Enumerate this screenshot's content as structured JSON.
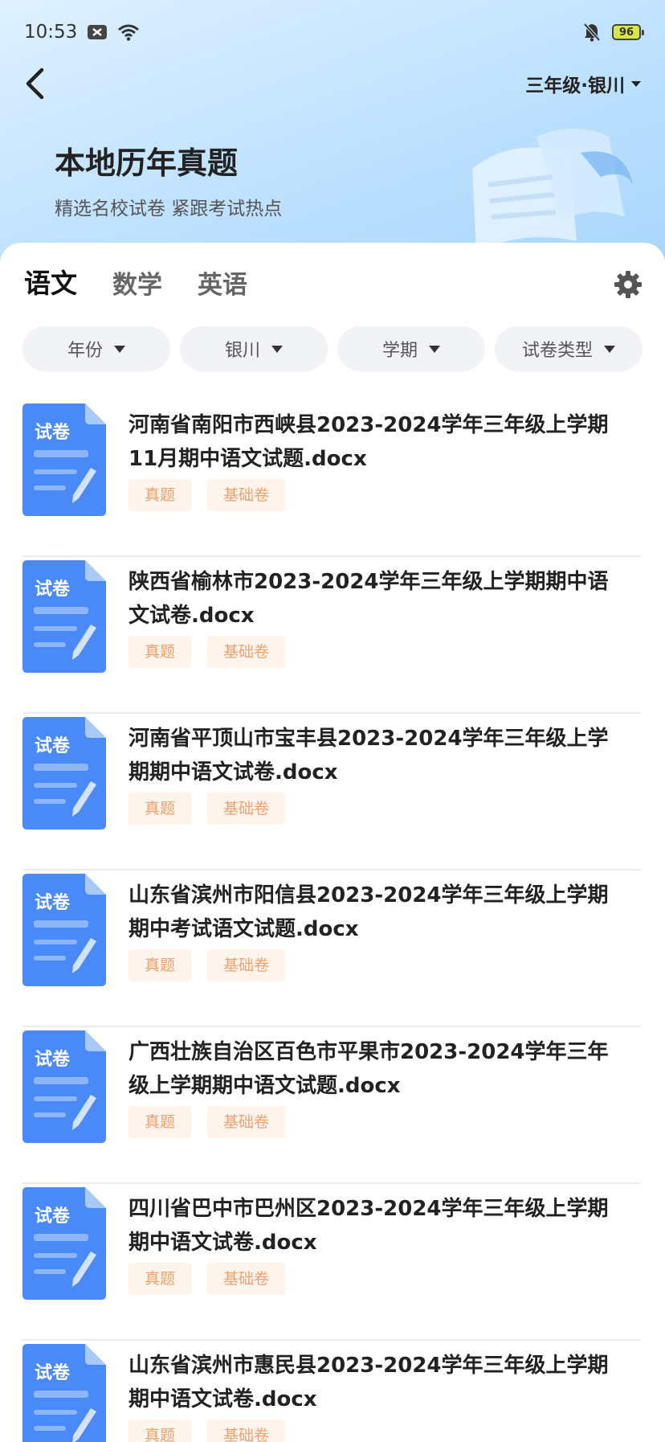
{
  "status_bar": {
    "time": "10:53",
    "battery": "96"
  },
  "header": {
    "grade_region": "三年级·银川",
    "title": "本地历年真题",
    "subtitle": "精选名校试卷 紧跟考试热点"
  },
  "tabs": [
    {
      "label": "语文",
      "active": true
    },
    {
      "label": "数学",
      "active": false
    },
    {
      "label": "英语",
      "active": false
    }
  ],
  "filters": [
    {
      "label": "年份"
    },
    {
      "label": "银川"
    },
    {
      "label": "学期"
    },
    {
      "label": "试卷类型"
    }
  ],
  "doc_icon_label": "试卷",
  "colors": {
    "accent": "#4a8af8",
    "tag_text": "#f0a06b",
    "tag_bg": "#fff4ec"
  },
  "papers": [
    {
      "title": "河南省南阳市西峡县2023-2024学年三年级上学期11月期中语文试题.docx",
      "tags": [
        "真题",
        "基础卷"
      ]
    },
    {
      "title": "陕西省榆林市2023-2024学年三年级上学期期中语文试卷.docx",
      "tags": [
        "真题",
        "基础卷"
      ]
    },
    {
      "title": "河南省平顶山市宝丰县2023-2024学年三年级上学期期中语文试卷.docx",
      "tags": [
        "真题",
        "基础卷"
      ]
    },
    {
      "title": "山东省滨州市阳信县2023-2024学年三年级上学期期中考试语文试题.docx",
      "tags": [
        "真题",
        "基础卷"
      ]
    },
    {
      "title": "广西壮族自治区百色市平果市2023-2024学年三年级上学期期中语文试题.docx",
      "tags": [
        "真题",
        "基础卷"
      ]
    },
    {
      "title": "四川省巴中市巴州区2023-2024学年三年级上学期期中语文试卷.docx",
      "tags": [
        "真题",
        "基础卷"
      ]
    },
    {
      "title": "山东省滨州市惠民县2023-2024学年三年级上学期期中语文试卷.docx",
      "tags": [
        "真题",
        "基础卷"
      ]
    }
  ]
}
